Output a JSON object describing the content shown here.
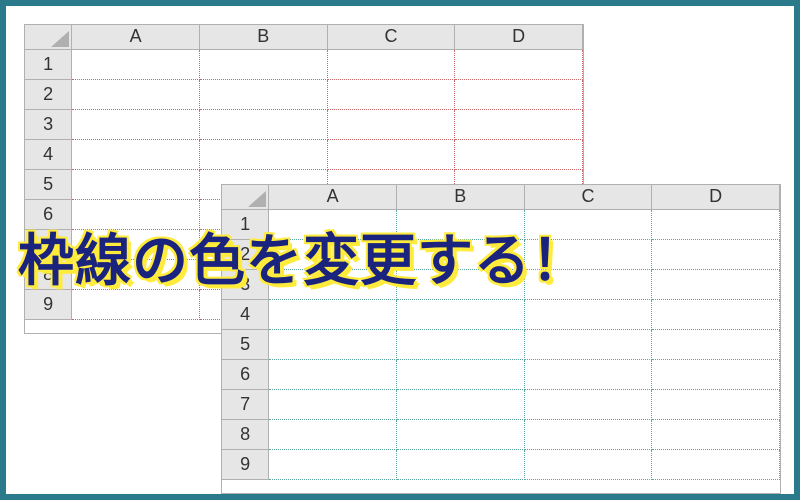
{
  "headline": "枠線の色を変更する！",
  "sheet1": {
    "gridline_color": "#c96a6a",
    "columns": [
      "A",
      "B",
      "C",
      "D"
    ],
    "rows": [
      "1",
      "2",
      "3",
      "4",
      "5",
      "6",
      "7",
      "8",
      "9"
    ]
  },
  "sheet2": {
    "gridline_color": "#5aa8a0",
    "columns": [
      "A",
      "B",
      "C",
      "D"
    ],
    "rows": [
      "1",
      "2",
      "3",
      "4",
      "5",
      "6",
      "7",
      "8",
      "9"
    ]
  }
}
